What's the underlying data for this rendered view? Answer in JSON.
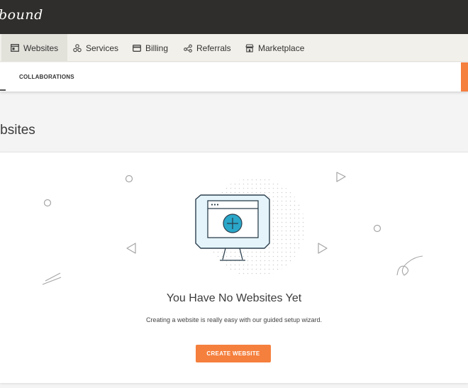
{
  "app": {
    "logo_text": "bound"
  },
  "nav": {
    "items": [
      {
        "label": "Websites",
        "icon": "browser-window-icon",
        "active": true
      },
      {
        "label": "Services",
        "icon": "services-icon",
        "active": false
      },
      {
        "label": "Billing",
        "icon": "credit-card-icon",
        "active": false
      },
      {
        "label": "Referrals",
        "icon": "share-icon",
        "active": false
      },
      {
        "label": "Marketplace",
        "icon": "storefront-icon",
        "active": false
      }
    ]
  },
  "subnav": {
    "tab_label": "COLLABORATIONS"
  },
  "page": {
    "title": "Websites"
  },
  "empty_state": {
    "title": "You Have No Websites Yet",
    "description": "Creating a website is really easy with our guided setup wizard.",
    "button_label": "CREATE WEBSITE",
    "illustration_icon": "monitor-add-icon"
  },
  "colors": {
    "topbar": "#2f2e2c",
    "nav_background": "#f2f0ea",
    "accent": "#f57f3d",
    "illustration_teal": "#2aa7c9"
  }
}
